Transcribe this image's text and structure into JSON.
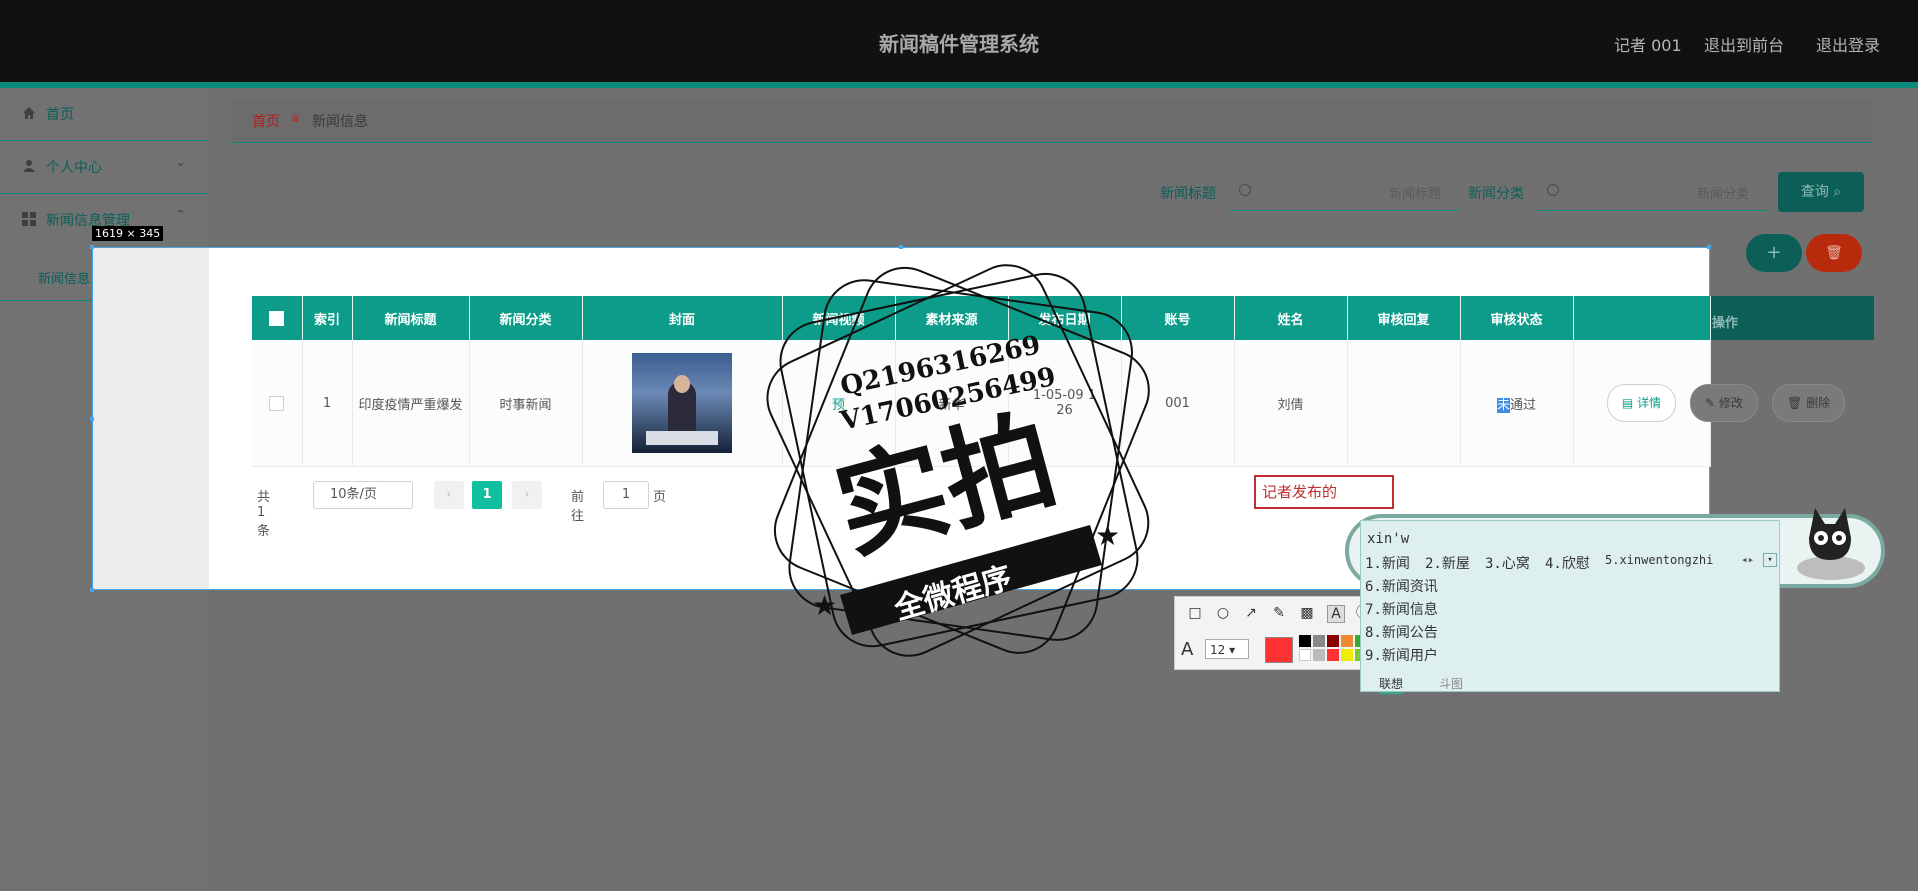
{
  "header": {
    "title": "新闻稿件管理系统",
    "user": "记者 001",
    "to_front": "退出到前台",
    "logout": "退出登录"
  },
  "sidebar": {
    "items": [
      {
        "label": "首页",
        "icon": "home-icon"
      },
      {
        "label": "个人中心",
        "icon": "user-icon"
      },
      {
        "label": "新闻信息管理",
        "icon": "grid-icon"
      }
    ],
    "sub_item": "新闻信息"
  },
  "breadcrumb": {
    "home": "首页",
    "current": "新闻信息"
  },
  "filters": {
    "title_label": "新闻标题",
    "title_placeholder": "新闻标题",
    "category_label": "新闻分类",
    "category_placeholder": "新闻分类",
    "search_button": "查询"
  },
  "actions": {
    "add": "+",
    "delete": "🗑"
  },
  "table": {
    "headers": [
      "索引",
      "新闻标题",
      "新闻分类",
      "封面",
      "新闻视频",
      "素材来源",
      "发布日期",
      "账号",
      "姓名",
      "审核回复",
      "审核状态"
    ],
    "op_header": "操作",
    "row": {
      "index": "1",
      "title": "印度疫情严重爆发",
      "category": "时事新闻",
      "video": "预",
      "source": "新华",
      "date_line1": "1-05-09 1",
      "date_line2": "26",
      "account": "001",
      "name": "刘倩",
      "reply": "",
      "status_hl": "未",
      "status_rest": "通过",
      "btn_detail": "详情",
      "btn_edit": "修改",
      "btn_delete": "删除"
    }
  },
  "pager": {
    "total": "共 1 条",
    "page_size": "10条/页",
    "current": "1",
    "goto": "前往",
    "goto_value": "1",
    "page_unit": "页"
  },
  "screenshot_tool": {
    "size_label": "1619 × 345",
    "text_input": "记者发布的",
    "font_size": "12"
  },
  "stamp": {
    "line1": "Q2196316269",
    "line2": "V17060256499",
    "big": "实拍",
    "ribbon": "全微程序"
  },
  "ime": {
    "pinyin": "xin'w",
    "candidates": [
      "1.新闻",
      "2.新屋",
      "3.心窝",
      "4.欣慰",
      "5.xinwentongzhi",
      "6.新闻资讯",
      "7.新闻信息",
      "8.新闻公告",
      "9.新闻用户"
    ],
    "tab1": "联想",
    "tab2": "斗图"
  }
}
